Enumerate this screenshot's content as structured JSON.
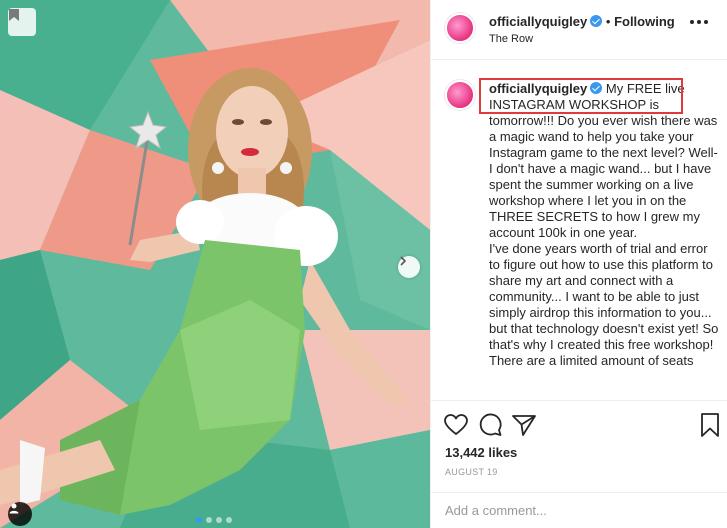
{
  "post": {
    "username": "officiallyquigley",
    "separator": "•",
    "follow_status": "Following",
    "location": "The Row",
    "caption_user": "officiallyquigley",
    "caption_text": "My FREE live INSTAGRAM WORKSHOP is tomorrow!!! Do you ever wish there was a magic wand to help you take your Instagram game to the next level? Well- I don't have a magic wand... but I have spent the summer working on a live workshop where I let you in on the THREE SECRETS to how I grew my account 100k in one year.\nI've done years worth of trial and error to figure out how to use this platform to share my art and connect with a community... I want to be able to just simply airdrop this information to you... but that technology doesn't exist yet! So that's why I created this free workshop!\nThere are a limited amount of seats",
    "likes": "13,442 likes",
    "date": "AUGUST 19",
    "comment_placeholder": "Add a comment..."
  },
  "carousel": {
    "count": 4,
    "active_index": 0
  },
  "icons": {
    "save_badge": "bookmark-icon",
    "next": "chevron-right-icon",
    "user_tag": "person-icon",
    "like": "heart-icon",
    "comment": "speech-bubble-icon",
    "share": "paper-plane-icon",
    "save": "bookmark-icon",
    "more": "ellipsis-icon"
  },
  "colors": {
    "accent": "#3897f0",
    "highlight": "#e03a3a"
  }
}
